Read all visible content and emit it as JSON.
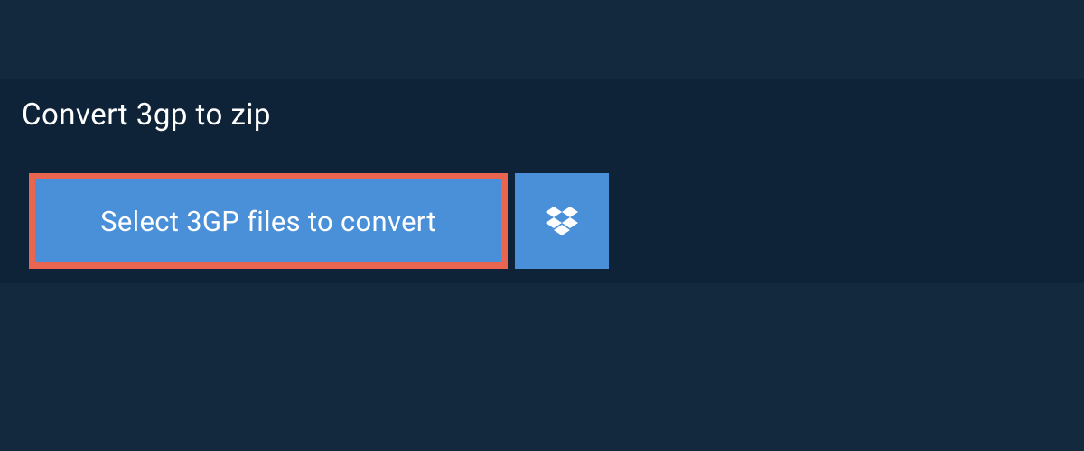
{
  "tab": {
    "title": "Convert 3gp to zip"
  },
  "buttons": {
    "select_label": "Select 3GP files to convert"
  },
  "colors": {
    "bg": "#13293d",
    "panel": "#0e2337",
    "button": "#4a90d9",
    "highlight_border": "#e96550"
  }
}
